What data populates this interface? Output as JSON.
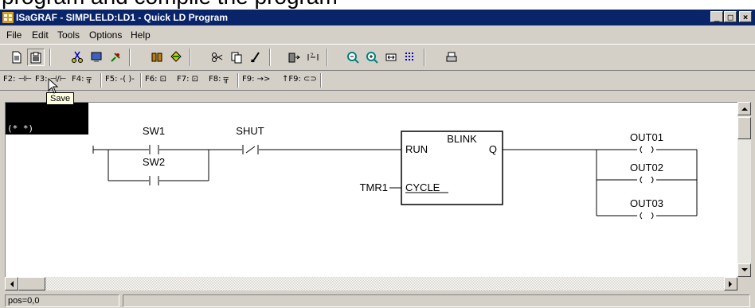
{
  "clipped_text": "program and compile the program",
  "window": {
    "title": "ISaGRAF - SIMPLELD:LD1 - Quick LD Program",
    "controls": {
      "minimize": "_",
      "maximize": "□",
      "close": "×"
    }
  },
  "menu": {
    "items": [
      {
        "label": "File"
      },
      {
        "label": "Edit"
      },
      {
        "label": "Tools"
      },
      {
        "label": "Options"
      },
      {
        "label": "Help"
      }
    ]
  },
  "toolbar": {
    "buttons": [
      {
        "name": "new-icon"
      },
      {
        "name": "save-icon",
        "pressed": true
      },
      {
        "name": "cut-icon"
      },
      {
        "name": "monitor-icon"
      },
      {
        "name": "search-tool-icon"
      },
      {
        "name": "dictionary-icon"
      },
      {
        "name": "symbols-icon"
      },
      {
        "name": "scissors-icon"
      },
      {
        "name": "copy-icon"
      },
      {
        "name": "paste-icon"
      },
      {
        "name": "goto-icon"
      },
      {
        "name": "insert-icon"
      },
      {
        "name": "zoom-out-icon"
      },
      {
        "name": "zoom-in-icon"
      },
      {
        "name": "fit-icon"
      },
      {
        "name": "grid-icon"
      },
      {
        "name": "print-icon"
      }
    ]
  },
  "ld_bar": {
    "keys": [
      {
        "label": "F2: ⊣⊢"
      },
      {
        "label": "F3: ⊣/⊢"
      },
      {
        "label": "F4: ╦"
      },
      {
        "label": "F5: -( )-"
      },
      {
        "label": "F6: ⊡"
      },
      {
        "label": "F7: ⊡"
      },
      {
        "label": "F8: ╦"
      },
      {
        "label": "F9: →>"
      },
      {
        "label": "↑F9: ⊂⊃"
      }
    ]
  },
  "tooltip": {
    "text": "Save"
  },
  "ladder": {
    "comment": "(* *)",
    "contacts": [
      {
        "name": "SW1"
      },
      {
        "name": "SW2"
      },
      {
        "name": "SHUT",
        "negated": true
      }
    ],
    "block": {
      "name": "BLINK",
      "inputs": [
        "RUN",
        "CYCLE"
      ],
      "output": "Q",
      "cycle_variable": "TMR1"
    },
    "coils": [
      {
        "name": "OUT01"
      },
      {
        "name": "OUT02"
      },
      {
        "name": "OUT03"
      }
    ]
  },
  "status": {
    "position": "pos=0,0"
  },
  "colors": {
    "titlebar": "#0a246a",
    "chrome": "#d4d0c8"
  }
}
